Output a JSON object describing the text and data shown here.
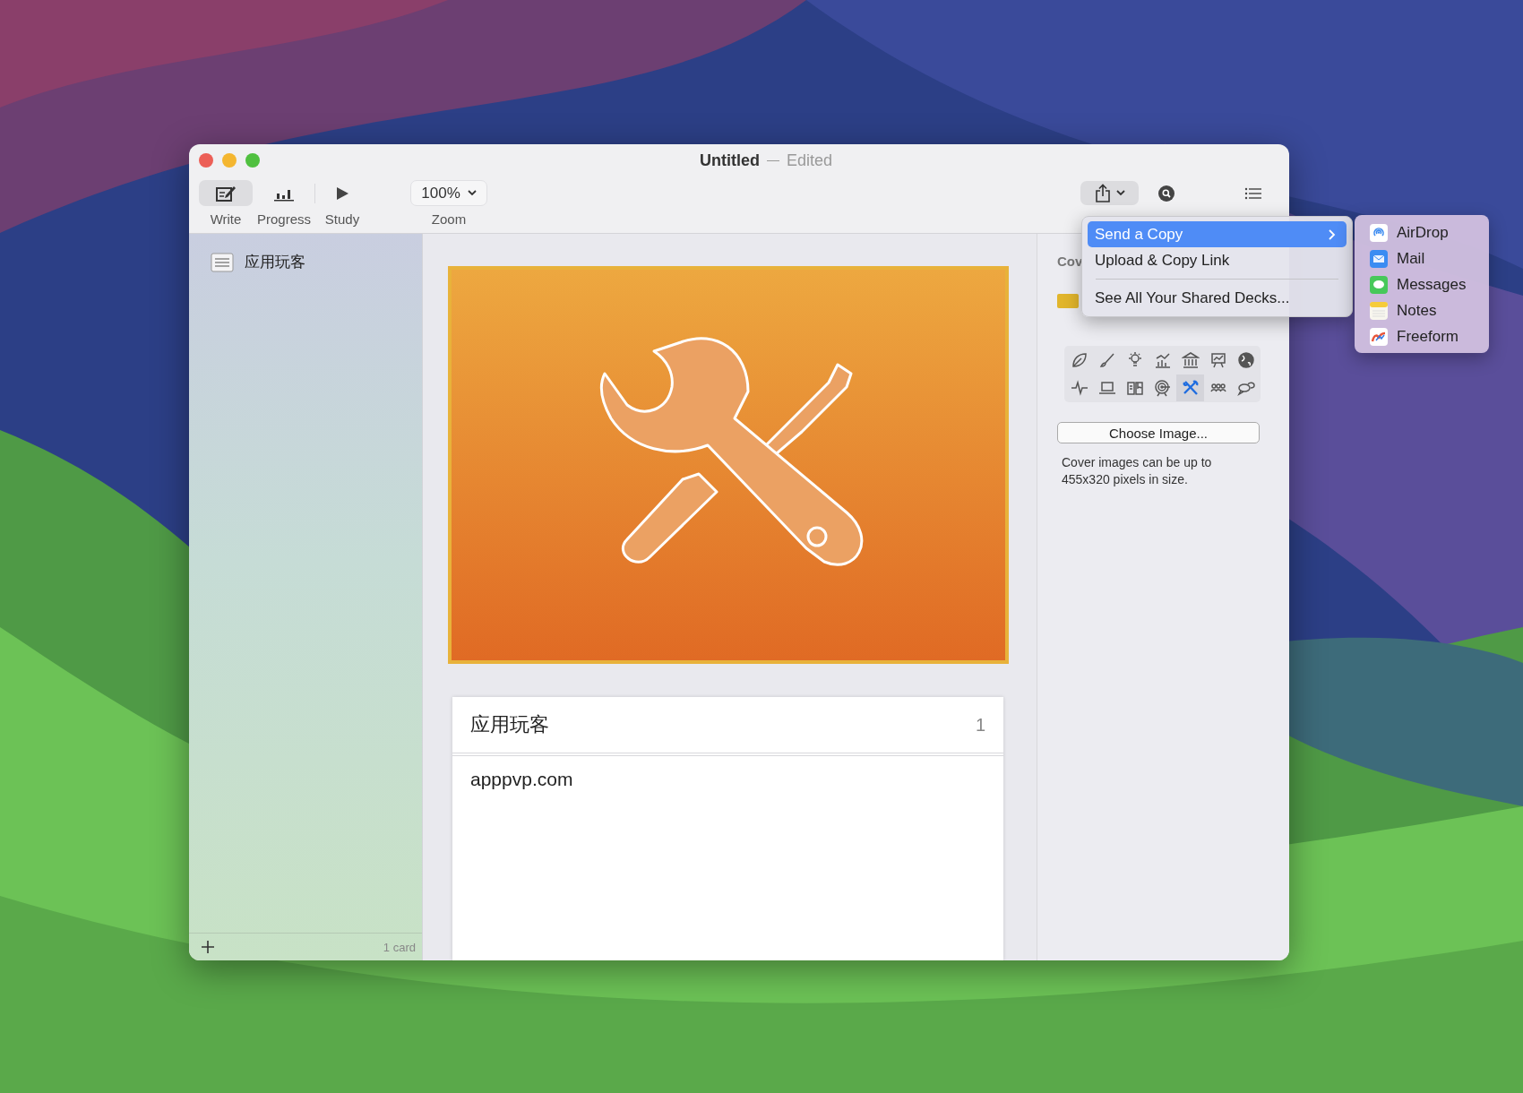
{
  "window": {
    "title": "Untitled",
    "status": "Edited"
  },
  "toolbar": {
    "modes": [
      {
        "label": "Write",
        "kind": "write",
        "selected": true
      },
      {
        "label": "Progress",
        "kind": "progress",
        "selected": false
      },
      {
        "label": "Study",
        "kind": "study",
        "selected": false
      }
    ],
    "zoom": {
      "value": "100%",
      "label": "Zoom"
    }
  },
  "sidebar": {
    "decks": [
      {
        "name": "应用玩客"
      }
    ],
    "count": "1 card"
  },
  "card": {
    "front": "应用玩客",
    "number": "1",
    "back": "apppvp.com"
  },
  "inspector": {
    "heading": "Cov",
    "icons": [
      {
        "kind": "leaf",
        "selected": false
      },
      {
        "kind": "brush",
        "selected": false
      },
      {
        "kind": "bulb",
        "selected": false
      },
      {
        "kind": "chart",
        "selected": false
      },
      {
        "kind": "bank",
        "selected": false
      },
      {
        "kind": "board",
        "selected": false
      },
      {
        "kind": "globe",
        "selected": false
      },
      {
        "kind": "pulse",
        "selected": false
      },
      {
        "kind": "laptop",
        "selected": false
      },
      {
        "kind": "book",
        "selected": false
      },
      {
        "kind": "target",
        "selected": false
      },
      {
        "kind": "tools",
        "selected": true
      },
      {
        "kind": "people",
        "selected": false
      },
      {
        "kind": "chat",
        "selected": false
      }
    ],
    "button": "Choose Image...",
    "note": "Cover images can be up to 455x320 pixels in size."
  },
  "share_menu": {
    "items": [
      {
        "label": "Send a Copy",
        "selected": true,
        "submenu": true
      },
      {
        "label": "Upload & Copy Link",
        "selected": false,
        "submenu": false
      },
      {
        "label": "See All Your Shared Decks...",
        "selected": false,
        "submenu": false
      }
    ],
    "submenu": [
      {
        "label": "AirDrop",
        "kind": "airdrop"
      },
      {
        "label": "Mail",
        "kind": "mail"
      },
      {
        "label": "Messages",
        "kind": "messages"
      },
      {
        "label": "Notes",
        "kind": "notes"
      },
      {
        "label": "Freeform",
        "kind": "freeform"
      }
    ]
  }
}
